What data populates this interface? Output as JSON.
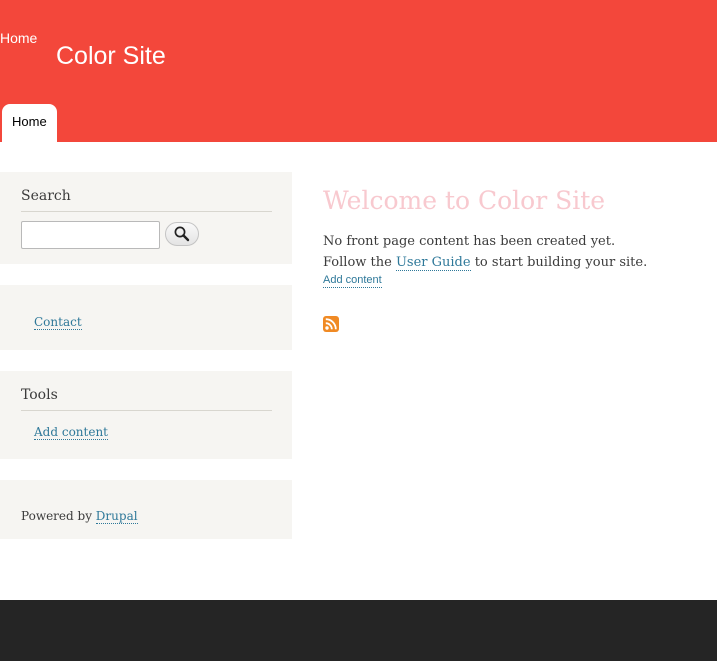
{
  "header": {
    "logo_text": "Home",
    "site_name": "Color Site",
    "menu": [
      {
        "label": "Home",
        "active": true
      }
    ]
  },
  "sidebar": {
    "search": {
      "title": "Search",
      "input_value": "",
      "button_icon": "magnifier-icon"
    },
    "contact": {
      "link": "Contact"
    },
    "tools": {
      "title": "Tools",
      "link": "Add content"
    },
    "powered": {
      "prefix": "Powered by ",
      "link": "Drupal"
    }
  },
  "main": {
    "title": "Welcome to Color Site",
    "line1": "No front page content has been created yet.",
    "line2_before": "Follow the ",
    "line2_link": "User Guide",
    "line2_after": " to start building your site.",
    "add_content": "Add content",
    "feed_icon": "rss-feed-icon"
  },
  "colors": {
    "header_bg": "#f3473b",
    "link": "#2e7899",
    "title": "#f8c9cf",
    "sidebar_bg": "#f6f5f2",
    "footer_bg": "#252525"
  }
}
